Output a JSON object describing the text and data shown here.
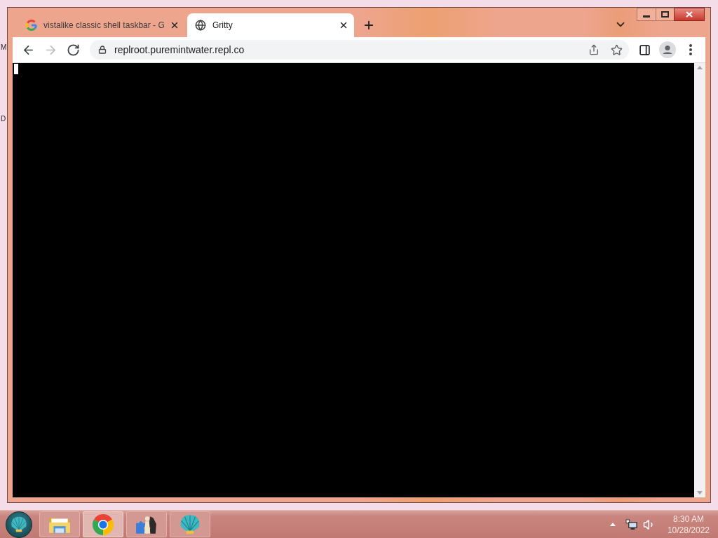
{
  "desktop": {
    "icon_labels": [
      "M",
      "D"
    ]
  },
  "window": {
    "tabs": [
      {
        "kind": "google",
        "title": "vistalike classic shell taskbar - G",
        "selected": false
      },
      {
        "kind": "globe",
        "title": "Gritty",
        "selected": true
      }
    ],
    "toolbar": {
      "nav": [
        {
          "kind": "back",
          "disabled": false
        },
        {
          "kind": "forward",
          "disabled": true
        },
        {
          "kind": "reload",
          "disabled": false
        }
      ],
      "address": "replroot.puremintwater.repl.co"
    }
  },
  "taskbar": {
    "items": [
      {
        "kind": "folder",
        "selected": false
      },
      {
        "kind": "chrome",
        "selected": true
      },
      {
        "kind": "chess",
        "selected": false
      },
      {
        "kind": "shell",
        "selected": false
      }
    ],
    "clock": {
      "time": "8:30 AM",
      "date": "10/28/2022"
    }
  }
}
